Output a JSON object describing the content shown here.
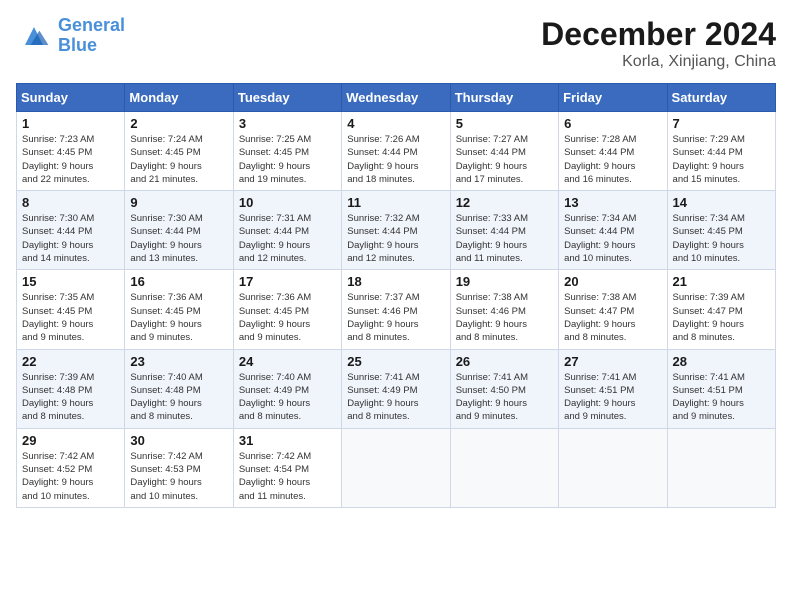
{
  "logo": {
    "line1": "General",
    "line2": "Blue"
  },
  "title": "December 2024",
  "subtitle": "Korla, Xinjiang, China",
  "days_of_week": [
    "Sunday",
    "Monday",
    "Tuesday",
    "Wednesday",
    "Thursday",
    "Friday",
    "Saturday"
  ],
  "weeks": [
    [
      {
        "day": "1",
        "info": "Sunrise: 7:23 AM\nSunset: 4:45 PM\nDaylight: 9 hours\nand 22 minutes."
      },
      {
        "day": "2",
        "info": "Sunrise: 7:24 AM\nSunset: 4:45 PM\nDaylight: 9 hours\nand 21 minutes."
      },
      {
        "day": "3",
        "info": "Sunrise: 7:25 AM\nSunset: 4:45 PM\nDaylight: 9 hours\nand 19 minutes."
      },
      {
        "day": "4",
        "info": "Sunrise: 7:26 AM\nSunset: 4:44 PM\nDaylight: 9 hours\nand 18 minutes."
      },
      {
        "day": "5",
        "info": "Sunrise: 7:27 AM\nSunset: 4:44 PM\nDaylight: 9 hours\nand 17 minutes."
      },
      {
        "day": "6",
        "info": "Sunrise: 7:28 AM\nSunset: 4:44 PM\nDaylight: 9 hours\nand 16 minutes."
      },
      {
        "day": "7",
        "info": "Sunrise: 7:29 AM\nSunset: 4:44 PM\nDaylight: 9 hours\nand 15 minutes."
      }
    ],
    [
      {
        "day": "8",
        "info": "Sunrise: 7:30 AM\nSunset: 4:44 PM\nDaylight: 9 hours\nand 14 minutes."
      },
      {
        "day": "9",
        "info": "Sunrise: 7:30 AM\nSunset: 4:44 PM\nDaylight: 9 hours\nand 13 minutes."
      },
      {
        "day": "10",
        "info": "Sunrise: 7:31 AM\nSunset: 4:44 PM\nDaylight: 9 hours\nand 12 minutes."
      },
      {
        "day": "11",
        "info": "Sunrise: 7:32 AM\nSunset: 4:44 PM\nDaylight: 9 hours\nand 12 minutes."
      },
      {
        "day": "12",
        "info": "Sunrise: 7:33 AM\nSunset: 4:44 PM\nDaylight: 9 hours\nand 11 minutes."
      },
      {
        "day": "13",
        "info": "Sunrise: 7:34 AM\nSunset: 4:44 PM\nDaylight: 9 hours\nand 10 minutes."
      },
      {
        "day": "14",
        "info": "Sunrise: 7:34 AM\nSunset: 4:45 PM\nDaylight: 9 hours\nand 10 minutes."
      }
    ],
    [
      {
        "day": "15",
        "info": "Sunrise: 7:35 AM\nSunset: 4:45 PM\nDaylight: 9 hours\nand 9 minutes."
      },
      {
        "day": "16",
        "info": "Sunrise: 7:36 AM\nSunset: 4:45 PM\nDaylight: 9 hours\nand 9 minutes."
      },
      {
        "day": "17",
        "info": "Sunrise: 7:36 AM\nSunset: 4:45 PM\nDaylight: 9 hours\nand 9 minutes."
      },
      {
        "day": "18",
        "info": "Sunrise: 7:37 AM\nSunset: 4:46 PM\nDaylight: 9 hours\nand 8 minutes."
      },
      {
        "day": "19",
        "info": "Sunrise: 7:38 AM\nSunset: 4:46 PM\nDaylight: 9 hours\nand 8 minutes."
      },
      {
        "day": "20",
        "info": "Sunrise: 7:38 AM\nSunset: 4:47 PM\nDaylight: 9 hours\nand 8 minutes."
      },
      {
        "day": "21",
        "info": "Sunrise: 7:39 AM\nSunset: 4:47 PM\nDaylight: 9 hours\nand 8 minutes."
      }
    ],
    [
      {
        "day": "22",
        "info": "Sunrise: 7:39 AM\nSunset: 4:48 PM\nDaylight: 9 hours\nand 8 minutes."
      },
      {
        "day": "23",
        "info": "Sunrise: 7:40 AM\nSunset: 4:48 PM\nDaylight: 9 hours\nand 8 minutes."
      },
      {
        "day": "24",
        "info": "Sunrise: 7:40 AM\nSunset: 4:49 PM\nDaylight: 9 hours\nand 8 minutes."
      },
      {
        "day": "25",
        "info": "Sunrise: 7:41 AM\nSunset: 4:49 PM\nDaylight: 9 hours\nand 8 minutes."
      },
      {
        "day": "26",
        "info": "Sunrise: 7:41 AM\nSunset: 4:50 PM\nDaylight: 9 hours\nand 9 minutes."
      },
      {
        "day": "27",
        "info": "Sunrise: 7:41 AM\nSunset: 4:51 PM\nDaylight: 9 hours\nand 9 minutes."
      },
      {
        "day": "28",
        "info": "Sunrise: 7:41 AM\nSunset: 4:51 PM\nDaylight: 9 hours\nand 9 minutes."
      }
    ],
    [
      {
        "day": "29",
        "info": "Sunrise: 7:42 AM\nSunset: 4:52 PM\nDaylight: 9 hours\nand 10 minutes."
      },
      {
        "day": "30",
        "info": "Sunrise: 7:42 AM\nSunset: 4:53 PM\nDaylight: 9 hours\nand 10 minutes."
      },
      {
        "day": "31",
        "info": "Sunrise: 7:42 AM\nSunset: 4:54 PM\nDaylight: 9 hours\nand 11 minutes."
      },
      {
        "day": "",
        "info": ""
      },
      {
        "day": "",
        "info": ""
      },
      {
        "day": "",
        "info": ""
      },
      {
        "day": "",
        "info": ""
      }
    ]
  ]
}
